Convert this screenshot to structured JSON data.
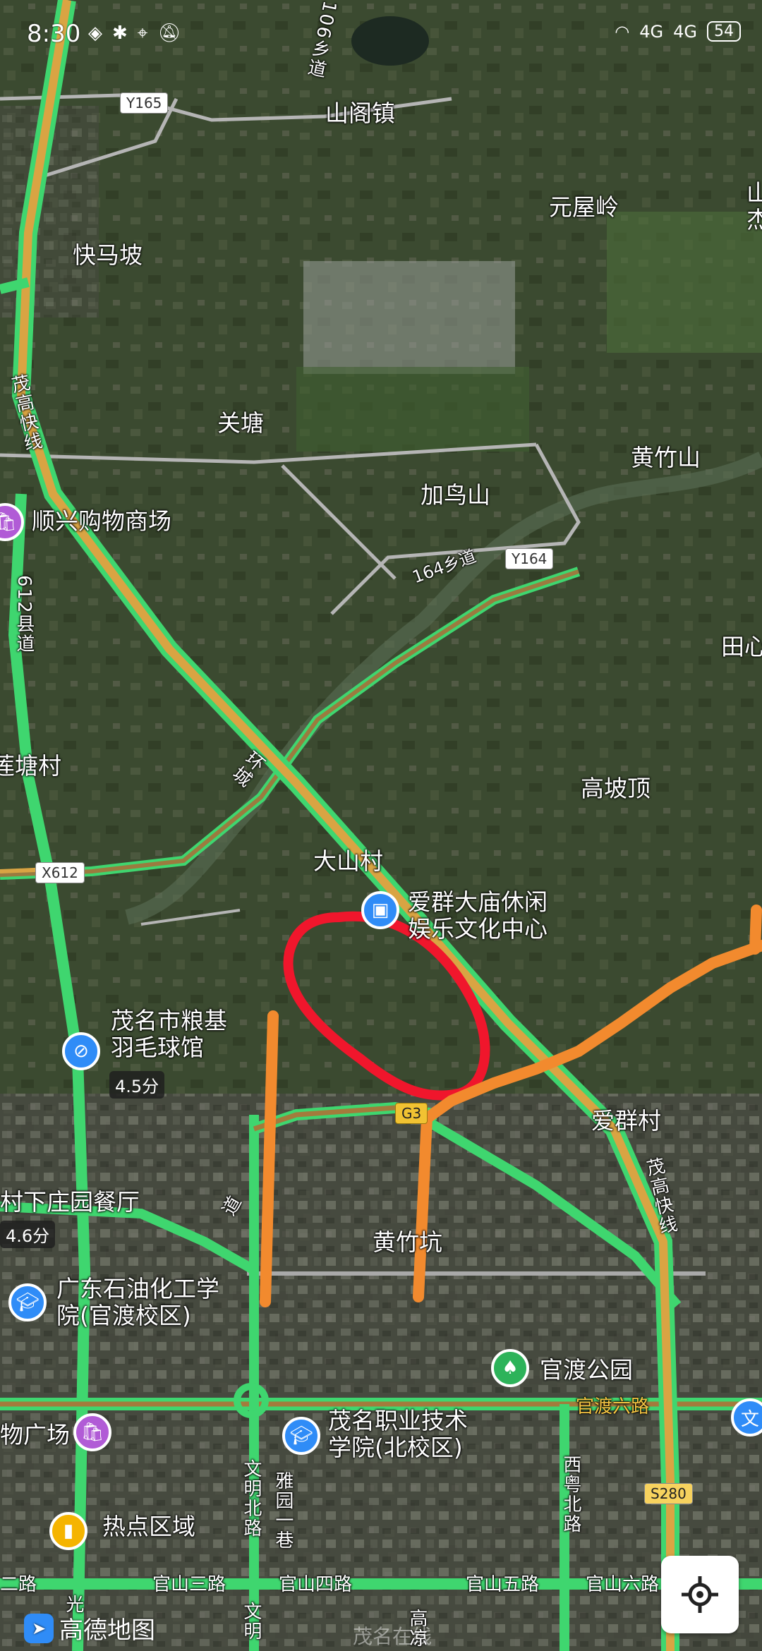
{
  "status_bar": {
    "time": "8:30",
    "network_1": "4G",
    "network_2": "4G",
    "battery": "54"
  },
  "places": {
    "shange_town": "山阁镇",
    "yuanwuling": "元屋岭",
    "kuaimapo": "快马坡",
    "guantang": "关塘",
    "huangzhushan": "黄竹山",
    "jianiaoshan": "加鸟山",
    "shunxing_mall": "顺兴购物商场",
    "tianxin": "田心",
    "gaopoding": "高坡顶",
    "lianitangcun": "莲塘村",
    "dashancun": "大山村",
    "aiqun_center": "爱群大庙休闲\n娱乐文化中心",
    "badminton": "茂名市粮基\n羽毛球馆",
    "aiquncun": "爱群村",
    "restaurant": "村下庄园餐厅",
    "huangzhukeng": "黄竹坑",
    "gdpt": "广东石油化工学\n院(官渡校区)",
    "guandu_park": "官渡公园",
    "plaza": "物广场",
    "maoming_vocational": "茂名职业技术\n学院(北校区)",
    "hotspot": "热点区域",
    "shanpartial": "山\n杰",
    "wen_partial": "文"
  },
  "roads": {
    "y165": "Y165",
    "y164": "Y164",
    "x612": "X612",
    "g3": "G3",
    "s280": "S280",
    "road_106": "106乡道",
    "road_164": "164乡道",
    "county_612": "612县道",
    "maogao_expressway": "茂高快线",
    "maogao_expressway2": "茂高快线",
    "guandu_6": "官渡六路",
    "guanshan_3": "官山三路",
    "guanshan_4": "官山四路",
    "guanshan_5": "官山五路",
    "guanshan_6": "官山六路",
    "wenming_north": "文明北路",
    "wenming": "文明",
    "yayuan": "雅园一巷",
    "xiyue_north": "西粤北路",
    "gaoliang": "高凉",
    "road_left": "二路",
    "guang": "光",
    "huanshi": "环城",
    "dada": "道"
  },
  "badges": {
    "badminton_time": "4.5分",
    "restaurant_time": "4.6分"
  },
  "app": {
    "logo_text": "高德地图",
    "watermark": "茂名在线"
  },
  "colors": {
    "expressway": "#d9a443",
    "traffic_green": "#3fd66f",
    "annotation_red": "#f0162c",
    "annotation_orange": "#f28a2e"
  }
}
